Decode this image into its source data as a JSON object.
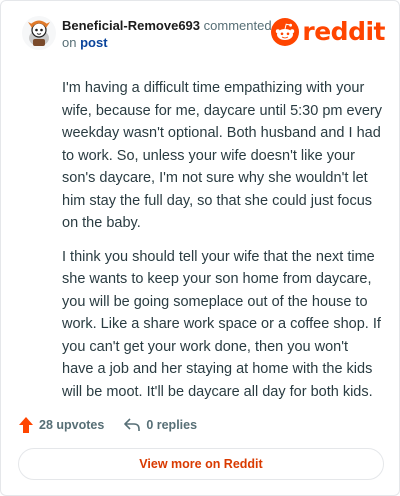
{
  "comment": {
    "username": "Beneficial-Remove693",
    "action_text": "commented",
    "on_text": "on",
    "post_link": "post",
    "paragraphs": [
      "I'm having a difficult time empathizing with your wife, because for me, daycare until 5:30 pm every weekday wasn't optional. Both husband and I had to work. So, unless your wife doesn't like your son's daycare, I'm not sure why she wouldn't let him stay the full day, so that she could just focus on the baby.",
      "I think you should tell your wife that the next time she wants to keep your son home from daycare, you will be going someplace out of the house to work. Like a share work space or a coffee shop. If you can't get your work done, then you won't have a job and her staying at home with the kids will be moot. It'll be daycare all day for both kids."
    ]
  },
  "brand": {
    "wordmark": "reddit",
    "color": "#ff4500"
  },
  "actions": {
    "upvotes": "28 upvotes",
    "replies": "0 replies"
  },
  "footer": {
    "view_more": "View more on Reddit"
  },
  "icons": [
    "avatar",
    "reddit-logo-icon",
    "upvote-arrow-icon",
    "reply-icon"
  ]
}
